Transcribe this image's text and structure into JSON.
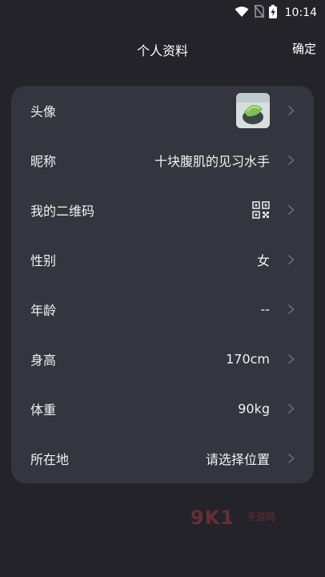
{
  "status_bar": {
    "time": "10:14",
    "icons": [
      "wifi-icon",
      "no-sim-icon",
      "battery-charging-icon"
    ]
  },
  "header": {
    "title": "个人资料",
    "confirm_label": "确定"
  },
  "profile": {
    "rows": [
      {
        "label": "头像",
        "value": "",
        "type": "avatar"
      },
      {
        "label": "昵称",
        "value": "十块腹肌的见习水手",
        "type": "text"
      },
      {
        "label": "我的二维码",
        "value": "",
        "type": "qr"
      },
      {
        "label": "性别",
        "value": "女",
        "type": "text"
      },
      {
        "label": "年龄",
        "value": "--",
        "type": "text"
      },
      {
        "label": "身高",
        "value": "170cm",
        "type": "text"
      },
      {
        "label": "体重",
        "value": "90kg",
        "type": "text"
      },
      {
        "label": "所在地",
        "value": "请选择位置",
        "type": "text"
      }
    ]
  },
  "watermark": {
    "number": "9K1",
    "text": "手游网"
  },
  "colors": {
    "background": "#232329",
    "card": "#35353f",
    "text": "#f2f2f2",
    "chevron": "#6b6b75"
  }
}
